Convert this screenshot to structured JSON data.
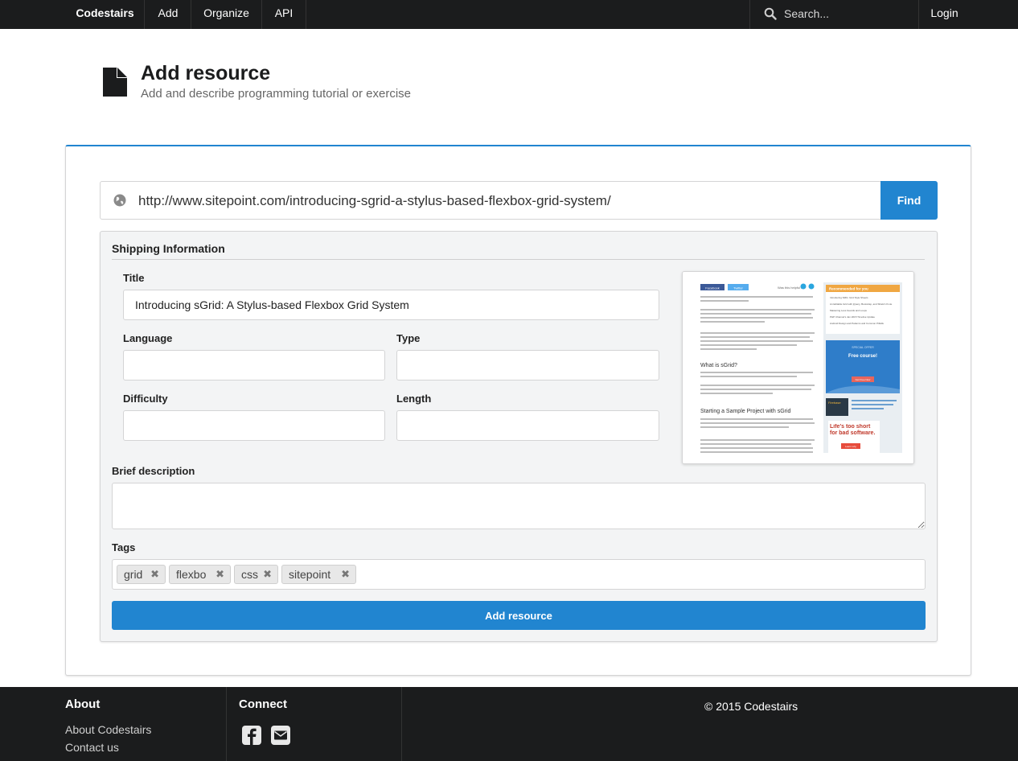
{
  "nav": {
    "brand": "Codestairs",
    "items": [
      {
        "label": "Add"
      },
      {
        "label": "Organize"
      },
      {
        "label": "API"
      }
    ],
    "search_placeholder": "Search...",
    "login": "Login"
  },
  "header": {
    "title": "Add resource",
    "subtitle": "Add and describe programming tutorial or exercise"
  },
  "url_bar": {
    "value": "http://www.sitepoint.com/introducing-sgrid-a-stylus-based-flexbox-grid-system/",
    "button": "Find"
  },
  "form": {
    "section_title": "Shipping Information",
    "title_label": "Title",
    "title_value": "Introducing sGrid: A Stylus-based Flexbox Grid System",
    "language_label": "Language",
    "language_value": "",
    "type_label": "Type",
    "type_value": "",
    "difficulty_label": "Difficulty",
    "difficulty_value": "",
    "length_label": "Length",
    "length_value": "",
    "description_label": "Brief description",
    "description_value": "",
    "tags_label": "Tags",
    "tags": [
      "grid",
      "flexbo",
      "css",
      "sitepoint"
    ],
    "tag_remove_glyph": "✖",
    "submit": "Add resource"
  },
  "preview": {
    "share_facebook": "Facebook",
    "share_twitter": "Twitter",
    "was_helpful": "Was this helpful?",
    "heading_what": "What is sGrid?",
    "heading_start": "Starting a Sample Project with sGrid",
    "sidebar_title": "Recommended for you",
    "sidebar_items": [
      "Introducing SMG: Grid Style Sheets",
      "An Editable Grid with jQuery, Bootstrap, and Shield UI Lite",
      "Mastering Less Guards and Loops",
      "PHP Channel's Jan 2015 Timeline Update",
      "Android Design and Patterns and Common Pitfalls"
    ],
    "promo_kicker": "SPECIAL OFFER",
    "promo_text": "Free course!",
    "promo_cta": "Get Free Now",
    "firebase_label": "Firebase",
    "ad_text": "Life's too short for bad software.",
    "ad_cta": "Learn why"
  },
  "footer": {
    "about_title": "About",
    "about_links": [
      "About Codestairs",
      "Contact us"
    ],
    "connect_title": "Connect",
    "copyright": "© 2015 Codestairs"
  },
  "colors": {
    "primary": "#2185d0",
    "dark": "#1b1c1d",
    "segment_bg": "#f3f4f5"
  },
  "icons": [
    "search-icon",
    "file-icon",
    "globe-icon",
    "remove-icon",
    "facebook-icon",
    "mail-icon"
  ]
}
